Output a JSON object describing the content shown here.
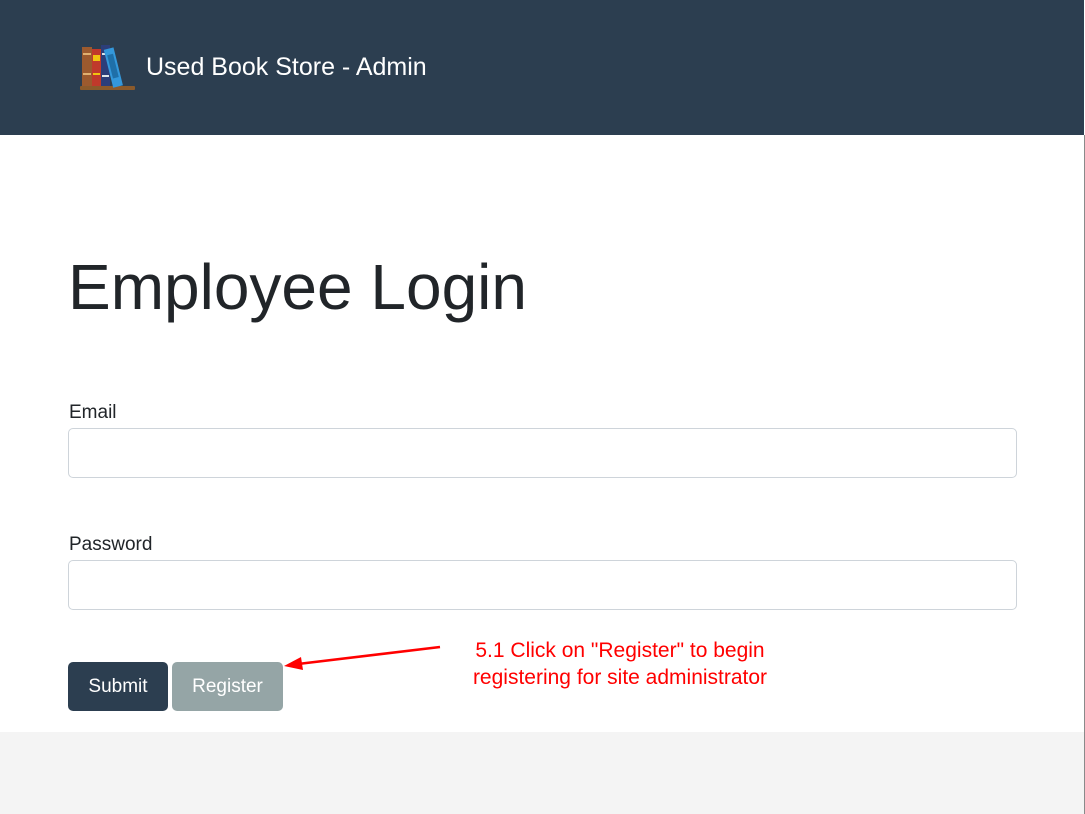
{
  "navbar": {
    "brand_text": "Used Book Store - Admin",
    "logo_icon": "books-icon"
  },
  "page": {
    "title": "Employee Login"
  },
  "form": {
    "email_label": "Email",
    "email_value": "",
    "password_label": "Password",
    "password_value": "",
    "submit_label": "Submit",
    "register_label": "Register"
  },
  "annotation": {
    "line1": "5.1 Click on \"Register\" to begin",
    "line2": "registering for site administrator",
    "color": "#ff0000"
  },
  "colors": {
    "navbar_bg": "#2c3e50",
    "submit_bg": "#2c3e50",
    "register_bg": "#95a5a6",
    "footer_bg": "#f4f4f4"
  }
}
